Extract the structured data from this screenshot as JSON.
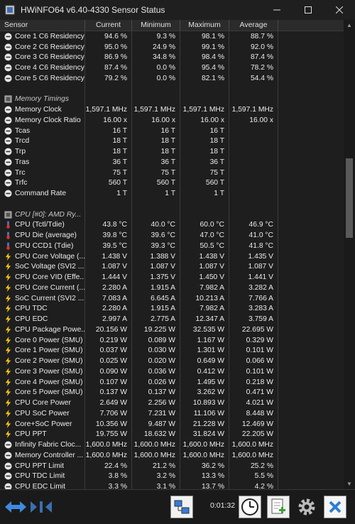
{
  "window": {
    "title": "HWiNFO64 v6.40-4330 Sensor Status"
  },
  "columns": {
    "sensor": "Sensor",
    "current": "Current",
    "minimum": "Minimum",
    "maximum": "Maximum",
    "average": "Average"
  },
  "rows": [
    {
      "icon": "minus",
      "name": "Core 1 C6 Residency",
      "cur": "94.6 %",
      "min": "9.3 %",
      "max": "98.1 %",
      "avg": "88.7 %"
    },
    {
      "icon": "minus",
      "name": "Core 2 C6 Residency",
      "cur": "95.0 %",
      "min": "24.9 %",
      "max": "99.1 %",
      "avg": "92.0 %"
    },
    {
      "icon": "minus",
      "name": "Core 3 C6 Residency",
      "cur": "86.9 %",
      "min": "34.8 %",
      "max": "98.4 %",
      "avg": "87.4 %"
    },
    {
      "icon": "minus",
      "name": "Core 4 C6 Residency",
      "cur": "87.4 %",
      "min": "0.0 %",
      "max": "95.4 %",
      "avg": "78.2 %"
    },
    {
      "icon": "minus",
      "name": "Core 5 C6 Residency",
      "cur": "79.2 %",
      "min": "0.0 %",
      "max": "82.1 %",
      "avg": "54.4 %"
    },
    {
      "icon": "none",
      "name": "",
      "cur": "",
      "min": "",
      "max": "",
      "avg": ""
    },
    {
      "icon": "chip",
      "name": "Memory Timings",
      "group": true,
      "cur": "",
      "min": "",
      "max": "",
      "avg": ""
    },
    {
      "icon": "minus",
      "name": "Memory Clock",
      "cur": "1,597.1 MHz",
      "min": "1,597.1 MHz",
      "max": "1,597.1 MHz",
      "avg": "1,597.1 MHz"
    },
    {
      "icon": "minus",
      "name": "Memory Clock Ratio",
      "cur": "16.00 x",
      "min": "16.00 x",
      "max": "16.00 x",
      "avg": "16.00 x"
    },
    {
      "icon": "minus",
      "name": "Tcas",
      "cur": "16 T",
      "min": "16 T",
      "max": "16 T",
      "avg": ""
    },
    {
      "icon": "minus",
      "name": "Trcd",
      "cur": "18 T",
      "min": "18 T",
      "max": "18 T",
      "avg": ""
    },
    {
      "icon": "minus",
      "name": "Trp",
      "cur": "18 T",
      "min": "18 T",
      "max": "18 T",
      "avg": ""
    },
    {
      "icon": "minus",
      "name": "Tras",
      "cur": "36 T",
      "min": "36 T",
      "max": "36 T",
      "avg": ""
    },
    {
      "icon": "minus",
      "name": "Trc",
      "cur": "75 T",
      "min": "75 T",
      "max": "75 T",
      "avg": ""
    },
    {
      "icon": "minus",
      "name": "Trfc",
      "cur": "560 T",
      "min": "560 T",
      "max": "560 T",
      "avg": ""
    },
    {
      "icon": "minus",
      "name": "Command Rate",
      "cur": "1 T",
      "min": "1 T",
      "max": "1 T",
      "avg": ""
    },
    {
      "icon": "none",
      "name": "",
      "cur": "",
      "min": "",
      "max": "",
      "avg": ""
    },
    {
      "icon": "chip",
      "name": "CPU [#0]: AMD Ry...",
      "group": true,
      "cur": "",
      "min": "",
      "max": "",
      "avg": ""
    },
    {
      "icon": "therm",
      "name": "CPU (Tctl/Tdie)",
      "cur": "43.8 °C",
      "min": "40.0 °C",
      "max": "60.0 °C",
      "avg": "46.9 °C"
    },
    {
      "icon": "therm",
      "name": "CPU Die (average)",
      "cur": "39.8 °C",
      "min": "39.6 °C",
      "max": "47.0 °C",
      "avg": "41.0 °C"
    },
    {
      "icon": "therm",
      "name": "CPU CCD1 (Tdie)",
      "cur": "39.5 °C",
      "min": "39.3 °C",
      "max": "50.5 °C",
      "avg": "41.8 °C"
    },
    {
      "icon": "bolt",
      "name": "CPU Core Voltage (...",
      "cur": "1.438 V",
      "min": "1.388 V",
      "max": "1.438 V",
      "avg": "1.435 V"
    },
    {
      "icon": "bolt",
      "name": "SoC Voltage (SVI2 ...",
      "cur": "1.087 V",
      "min": "1.087 V",
      "max": "1.087 V",
      "avg": "1.087 V"
    },
    {
      "icon": "bolt",
      "name": "CPU Core VID (Effe...",
      "cur": "1.444 V",
      "min": "1.375 V",
      "max": "1.450 V",
      "avg": "1.441 V"
    },
    {
      "icon": "bolt",
      "name": "CPU Core Current (...",
      "cur": "2.280 A",
      "min": "1.915 A",
      "max": "7.982 A",
      "avg": "3.282 A"
    },
    {
      "icon": "bolt",
      "name": "SoC Current (SVI2 ...",
      "cur": "7.083 A",
      "min": "6.645 A",
      "max": "10.213 A",
      "avg": "7.766 A"
    },
    {
      "icon": "bolt",
      "name": "CPU TDC",
      "cur": "2.280 A",
      "min": "1.915 A",
      "max": "7.982 A",
      "avg": "3.283 A"
    },
    {
      "icon": "bolt",
      "name": "CPU EDC",
      "cur": "2.997 A",
      "min": "2.775 A",
      "max": "12.347 A",
      "avg": "3.759 A"
    },
    {
      "icon": "bolt",
      "name": "CPU Package Powe...",
      "cur": "20.156 W",
      "min": "19.225 W",
      "max": "32.535 W",
      "avg": "22.695 W"
    },
    {
      "icon": "bolt",
      "name": "Core 0 Power (SMU)",
      "cur": "0.219 W",
      "min": "0.089 W",
      "max": "1.167 W",
      "avg": "0.329 W"
    },
    {
      "icon": "bolt",
      "name": "Core 1 Power (SMU)",
      "cur": "0.037 W",
      "min": "0.030 W",
      "max": "1.301 W",
      "avg": "0.101 W"
    },
    {
      "icon": "bolt",
      "name": "Core 2 Power (SMU)",
      "cur": "0.025 W",
      "min": "0.020 W",
      "max": "0.649 W",
      "avg": "0.066 W"
    },
    {
      "icon": "bolt",
      "name": "Core 3 Power (SMU)",
      "cur": "0.090 W",
      "min": "0.036 W",
      "max": "0.412 W",
      "avg": "0.101 W"
    },
    {
      "icon": "bolt",
      "name": "Core 4 Power (SMU)",
      "cur": "0.107 W",
      "min": "0.026 W",
      "max": "1.495 W",
      "avg": "0.218 W"
    },
    {
      "icon": "bolt",
      "name": "Core 5 Power (SMU)",
      "cur": "0.137 W",
      "min": "0.137 W",
      "max": "3.262 W",
      "avg": "0.471 W"
    },
    {
      "icon": "bolt",
      "name": "CPU Core Power",
      "cur": "2.649 W",
      "min": "2.256 W",
      "max": "10.893 W",
      "avg": "4.021 W"
    },
    {
      "icon": "bolt",
      "name": "CPU SoC Power",
      "cur": "7.706 W",
      "min": "7.231 W",
      "max": "11.106 W",
      "avg": "8.448 W"
    },
    {
      "icon": "bolt",
      "name": "Core+SoC Power",
      "cur": "10.356 W",
      "min": "9.487 W",
      "max": "21.228 W",
      "avg": "12.469 W"
    },
    {
      "icon": "bolt",
      "name": "CPU PPT",
      "cur": "19.755 W",
      "min": "18.632 W",
      "max": "31.824 W",
      "avg": "22.205 W"
    },
    {
      "icon": "minus",
      "name": "Infinity Fabric Cloc...",
      "cur": "1,600.0 MHz",
      "min": "1,600.0 MHz",
      "max": "1,600.0 MHz",
      "avg": "1,600.0 MHz"
    },
    {
      "icon": "minus",
      "name": "Memory Controller ...",
      "cur": "1,600.0 MHz",
      "min": "1,600.0 MHz",
      "max": "1,600.0 MHz",
      "avg": "1,600.0 MHz"
    },
    {
      "icon": "minus",
      "name": "CPU PPT Limit",
      "cur": "22.4 %",
      "min": "21.2 %",
      "max": "36.2 %",
      "avg": "25.2 %"
    },
    {
      "icon": "minus",
      "name": "CPU TDC Limit",
      "cur": "3.8 %",
      "min": "3.2 %",
      "max": "13.3 %",
      "avg": "5.5 %"
    },
    {
      "icon": "minus",
      "name": "CPU EDC Limit",
      "cur": "3.3 %",
      "min": "3.1 %",
      "max": "13.7 %",
      "avg": "4.2 %"
    }
  ],
  "toolbar": {
    "elapsed": "0:01:32"
  },
  "colors": {
    "bolt": "#f5c211",
    "therm_blue": "#3a7bd5",
    "therm_red": "#d8332a",
    "close_x": "#2d7fd1"
  }
}
